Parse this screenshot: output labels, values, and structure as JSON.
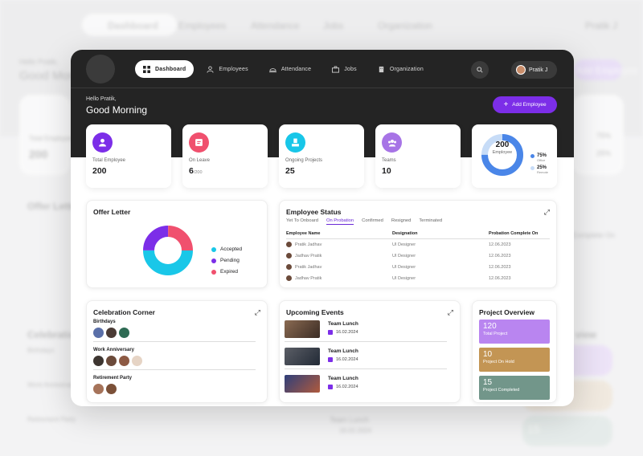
{
  "nav": {
    "items": [
      {
        "label": "Dashboard",
        "icon": "grid-icon",
        "active": true
      },
      {
        "label": "Employees",
        "icon": "user-icon",
        "active": false
      },
      {
        "label": "Attendance",
        "icon": "cloche-icon",
        "active": false
      },
      {
        "label": "Jobs",
        "icon": "briefcase-icon",
        "active": false
      },
      {
        "label": "Organization",
        "icon": "building-icon",
        "active": false
      }
    ],
    "user": "Pratik J"
  },
  "bg": {
    "dashboard": "Dashboard",
    "employees": "Employees",
    "attendance": "Attendance",
    "jobs": "Jobs",
    "organization": "Organization",
    "hello": "Hello Pratik,",
    "greeting": "Good Morning",
    "total_label": "Total Employee",
    "total": "200",
    "offer": "Offer Letter",
    "celebration": "Celebration",
    "birthdays": "Birthdays",
    "work_anniv": "Work Anniversary",
    "retirement": "Retirement Party",
    "event_title": "Team Lunch",
    "event_date": "16.02.2024",
    "on_text": "Complete On",
    "overview": "view",
    "proj_num": "15",
    "pct_a": "75%",
    "pct_b": "25%",
    "user": "Pratik J",
    "add": "Add Employee"
  },
  "header": {
    "hello": "Hello Pratik,",
    "greeting": "Good Morning",
    "add_button": "Add Employee"
  },
  "stats": [
    {
      "label": "Total Employee",
      "value": "200",
      "suffix": "",
      "color": "#7c2ee8"
    },
    {
      "label": "On Leave",
      "value": "6",
      "suffix": "/200",
      "color": "#f0506e"
    },
    {
      "label": "Ongoing Projects",
      "value": "25",
      "suffix": "",
      "color": "#18c6e8"
    },
    {
      "label": "Teams",
      "value": "10",
      "suffix": "",
      "color": "#a774e6"
    }
  ],
  "employee_donut": {
    "total": "200",
    "label": "Employee",
    "office_pct": "75%",
    "office_label": "Office",
    "remote_pct": "25%",
    "remote_label": "Remote",
    "colors": {
      "office": "#4a86e8",
      "remote": "#c7dcf7"
    },
    "office_fraction": 0.75
  },
  "offer_letter": {
    "title": "Offer Letter",
    "legend": [
      {
        "label": "Accepted",
        "color": "#19c7e8",
        "fraction": 0.5
      },
      {
        "label": "Pending",
        "color": "#7c2ee8",
        "fraction": 0.25
      },
      {
        "label": "Expired",
        "color": "#f0506e",
        "fraction": 0.25
      }
    ]
  },
  "employee_status": {
    "title": "Employee Status",
    "tabs": [
      "Yet To Onboard",
      "On Probation",
      "Confirmed",
      "Resigned",
      "Terminated"
    ],
    "active_tab": 1,
    "columns": [
      "Employee Name",
      "Designation",
      "Probation Complete On"
    ],
    "rows": [
      [
        "Pratik Jadhav",
        "UI Designer",
        "12.06.2023"
      ],
      [
        "Jadhav Pratik",
        "UI Designer",
        "12.06.2023"
      ],
      [
        "Pratik Jadhav",
        "UI Designer",
        "12.06.2023"
      ],
      [
        "Jadhav Pratik",
        "UI Designer",
        "12.06.2023"
      ]
    ]
  },
  "celebration": {
    "title": "Celebration Corner",
    "birthdays": "Birthdays",
    "work_anniversary": "Work Anniversary",
    "retirement": "Retirement Party"
  },
  "events": {
    "title": "Upcoming Events",
    "items": [
      {
        "title": "Team Lunch",
        "date": "16.02.2024"
      },
      {
        "title": "Team Lunch",
        "date": "16.02.2024"
      },
      {
        "title": "Team Lunch",
        "date": "16.02.2024"
      }
    ]
  },
  "projects": {
    "title": "Project Overview",
    "items": [
      {
        "value": "120",
        "label": "Total Project",
        "color": "#b985f0"
      },
      {
        "value": "10",
        "label": "Project On Hold",
        "color": "#c39554"
      },
      {
        "value": "15",
        "label": "Project Completed",
        "color": "#72968a"
      }
    ]
  }
}
